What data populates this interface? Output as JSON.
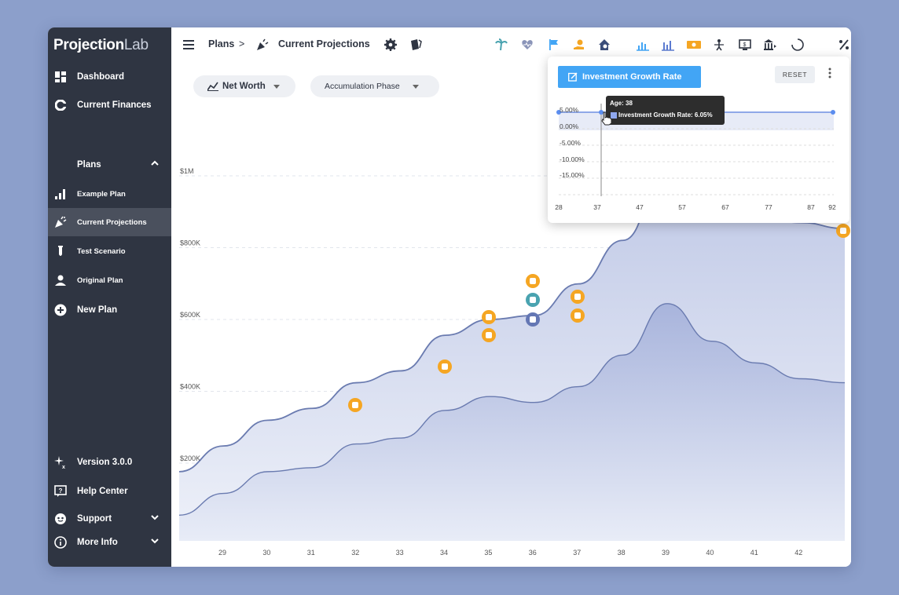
{
  "app": {
    "logo_main": "Projection",
    "logo_light": "Lab"
  },
  "sidebar": {
    "items": [
      {
        "label": "Dashboard",
        "icon": "dashboard-icon"
      },
      {
        "label": "Current Finances",
        "icon": "finances-icon"
      },
      {
        "label": "Plans",
        "icon": "chevron-up-icon"
      },
      {
        "label": "Example Plan",
        "icon": "bar-chart-icon"
      },
      {
        "label": "Current Projections",
        "icon": "party-popper-icon"
      },
      {
        "label": "Test Scenario",
        "icon": "test-tube-icon"
      },
      {
        "label": "Original Plan",
        "icon": "person-icon"
      },
      {
        "label": "New Plan",
        "icon": "plus-circle-icon"
      }
    ],
    "bottom": [
      {
        "label": "Version 3.0.0",
        "icon": "sparkle-icon"
      },
      {
        "label": "Help Center",
        "icon": "help-icon"
      },
      {
        "label": "Support",
        "icon": "support-icon"
      },
      {
        "label": "More Info",
        "icon": "info-icon"
      }
    ]
  },
  "topbar": {
    "crumb_plans": "Plans",
    "crumb_sep": ">",
    "crumb_current": "Current Projections"
  },
  "controls": {
    "metric": "Net Worth",
    "phase": "Accumulation Phase"
  },
  "popup": {
    "button_label": "Investment Growth Rate",
    "reset_label": "RESET",
    "tooltip_age": "Age: 38",
    "tooltip_rate": "Investment Growth Rate: 6.05%",
    "y_ticks": [
      "5.00%",
      "0.00%",
      "-5.00%",
      "-10.00%",
      "-15.00%"
    ],
    "x_ticks": [
      "28",
      "37",
      "47",
      "57",
      "67",
      "77",
      "87",
      "92"
    ]
  },
  "chart_data": {
    "type": "area",
    "x": [
      28,
      29,
      30,
      31,
      32,
      33,
      34,
      35,
      36,
      37,
      38,
      39,
      40,
      41,
      42,
      43
    ],
    "x_ticks": [
      "29",
      "30",
      "31",
      "32",
      "33",
      "34",
      "35",
      "36",
      "37",
      "38",
      "39",
      "40",
      "41",
      "42"
    ],
    "y_ticks": [
      "$200K",
      "$400K",
      "$600K",
      "$800K",
      "$1M"
    ],
    "ylim": [
      0,
      1100000
    ],
    "series": [
      {
        "values": [
          175000,
          240000,
          305000,
          335000,
          400000,
          430000,
          520000,
          560000,
          570000,
          650000,
          760000,
          940000,
          860000,
          820000,
          805000,
          790000
        ]
      },
      {
        "values": [
          65000,
          120000,
          175000,
          185000,
          245000,
          260000,
          330000,
          365000,
          350000,
          390000,
          470000,
          600000,
          505000,
          450000,
          410000,
          400000
        ]
      }
    ],
    "colors": {
      "line": "#6a7bb0",
      "fill_top": "#c8d0e8",
      "fill_bottom": "#f2f4fa"
    }
  }
}
